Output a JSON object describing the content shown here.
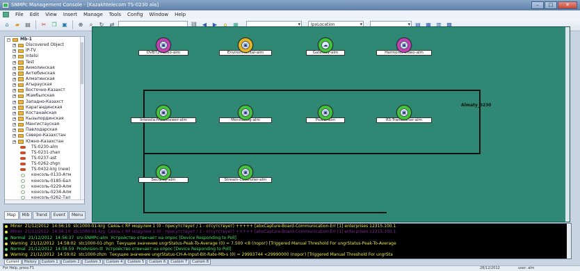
{
  "window": {
    "title": "SNMPc Management Console - [Kazakhtelecom TS-0230 ala]",
    "buttons": [
      "–",
      "□",
      "✕"
    ]
  },
  "menu": [
    "File",
    "Edit",
    "View",
    "Insert",
    "Manage",
    "Tools",
    "Config",
    "Window",
    "Help"
  ],
  "toolbar": {
    "icons": [
      "app-icon",
      "folder-icon",
      "print-icon",
      "cut-icon",
      "copy-icon",
      "paste-icon",
      "zoom-icon",
      "search-icon",
      "refresh-icon",
      "route-icon",
      "link-icon",
      "back-icon",
      "forward-icon",
      "home-icon",
      "map-icon"
    ],
    "zoom_value": "",
    "location_combo": "IpxLocation",
    "field_combo": "",
    "right_icons": [
      "table-icon",
      "grid-icon",
      "chart-icon",
      "bars-icon"
    ]
  },
  "tree": {
    "items": [
      {
        "label": "Mb-1",
        "kind": "root",
        "indent": 0
      },
      {
        "label": "Discovered Object",
        "kind": "folder",
        "indent": 1
      },
      {
        "label": "IP-TV",
        "kind": "folder",
        "indent": 1
      },
      {
        "label": "Intelsi",
        "kind": "folder",
        "indent": 1
      },
      {
        "label": "Test",
        "kind": "folder",
        "indent": 1
      },
      {
        "label": "Акмолинская",
        "kind": "folder",
        "indent": 1
      },
      {
        "label": "Актюбинская",
        "kind": "folder",
        "indent": 1
      },
      {
        "label": "Алматинская",
        "kind": "folder",
        "indent": 1
      },
      {
        "label": "Атырауская",
        "kind": "folder",
        "indent": 1
      },
      {
        "label": "Восточно-Казахст",
        "kind": "folder",
        "indent": 1
      },
      {
        "label": "Жамбылская",
        "kind": "folder",
        "indent": 1
      },
      {
        "label": "Западно-Казахст",
        "kind": "folder",
        "indent": 1
      },
      {
        "label": "Карагандинская",
        "kind": "folder",
        "indent": 1
      },
      {
        "label": "Костанайская",
        "kind": "folder",
        "indent": 1
      },
      {
        "label": "Кызылординская",
        "kind": "folder",
        "indent": 1
      },
      {
        "label": "Мангистауская",
        "kind": "folder",
        "indent": 1
      },
      {
        "label": "Павлодарская",
        "kind": "folder",
        "indent": 1
      },
      {
        "label": "Северо-Казахстан",
        "kind": "folder",
        "indent": 1
      },
      {
        "label": "Южно-Казахстан",
        "kind": "folder",
        "indent": 1
      },
      {
        "label": "TS-0230-alm",
        "kind": "device",
        "indent": 2
      },
      {
        "label": "TS-0231-zhan",
        "kind": "device",
        "indent": 2
      },
      {
        "label": "TS-0237-ast",
        "kind": "device",
        "indent": 2
      },
      {
        "label": "TS-0262-zhgn",
        "kind": "device",
        "indent": 2
      },
      {
        "label": "TS-0432-krg (new)",
        "kind": "device",
        "indent": 2
      },
      {
        "label": "консоль-0133-Атм",
        "kind": "sub",
        "indent": 2
      },
      {
        "label": "консоль-0185-Бал",
        "kind": "sub",
        "indent": 2
      },
      {
        "label": "консоль-0229-Алм",
        "kind": "sub",
        "indent": 2
      },
      {
        "label": "консоль-0234-Алм",
        "kind": "sub",
        "indent": 2
      },
      {
        "label": "консоль-0262-Тал",
        "kind": "sub",
        "indent": 2
      }
    ]
  },
  "left_tabs": [
    "Map",
    "Mib",
    "Trend",
    "Event",
    "Menu"
  ],
  "map": {
    "name": "Almaty_0230",
    "nodes": [
      {
        "label": "DVBT2-Audio-alm",
        "color": "#c23fb6",
        "kind": "dev",
        "col": 0,
        "row": 0
      },
      {
        "label": "Environmental-alm",
        "color": "#e6b321",
        "kind": "dev",
        "col": 1,
        "row": 0
      },
      {
        "label": "Gateway-alm",
        "color": "#42c43a",
        "kind": "cloud",
        "col": 2,
        "row": 0
      },
      {
        "label": "Harmonic-Video-alm",
        "color": "#c23fb6",
        "kind": "dev",
        "col": 3,
        "row": 0
      },
      {
        "label": "Inteosla-Multiviewer-alm",
        "color": "#42c43a",
        "kind": "dev",
        "col": 0,
        "row": 1
      },
      {
        "label": "Monitoring-alm",
        "color": "#42c43a",
        "kind": "dev",
        "col": 1,
        "row": 1
      },
      {
        "label": "Power-alm",
        "color": "#42c43a",
        "kind": "dev",
        "col": 2,
        "row": 1
      },
      {
        "label": "RS-Transmitter-alm",
        "color": "#42c43a",
        "kind": "dev",
        "col": 3,
        "row": 1
      },
      {
        "label": "Security-alm",
        "color": "#42c43a",
        "kind": "dev",
        "col": 0,
        "row": 2
      },
      {
        "label": "Stream-Controller-alm",
        "color": "#42c43a",
        "kind": "dev",
        "col": 1,
        "row": 2
      }
    ]
  },
  "alarms": [
    {
      "severity": "Minor",
      "date": "21/12/2012",
      "time": "14:56:10",
      "source": "stc1000-01-krg",
      "text": "Связь с RF модулем 1 (0 - присутствует / 1 - отсутствует) +++++ [abxCapture-Board-Communication-Err [1] enterprises 12315.100.1",
      "color": "#e8e84a",
      "dot": "#e8e84a"
    },
    {
      "severity": "Minor",
      "date": "21/12/2012",
      "time": "14:56:10",
      "source": "stc1000-01-krg",
      "text": "Связь с RF модулем 1 (0 - присутствует / 1 - отсутствует) +++++ [abxCapture-Board-Communication-Err [1] enterprises 12315.100.1",
      "color": "#7a2a96",
      "dot": "#e8e84a"
    },
    {
      "severity": "Normal",
      "date": "21/12/2012",
      "time": "14:56:37",
      "source": "srv-SNMPc-alm",
      "text": "Устройство отвечает на опрос   [Device Responding to Poll]",
      "color": "#49e26a",
      "dot": "#49e26a"
    },
    {
      "severity": "Warning",
      "date": "21/12/2012",
      "time": "14:58:02",
      "source": "stc1000-01-zhgn",
      "text": "Текущее значение ungrStatus-Peak-To-Average (0) = 7.500 <8 (порог) [Triggered Manual Threshold For ungrStatus-Peak-To-Average",
      "color": "#e8e84a",
      "dot": "#e8e84a"
    },
    {
      "severity": "Normal",
      "date": "21/12/2012",
      "time": "14:58:59",
      "source": "Prodvision-tt",
      "text": "Устройство отвечает на опрос   [Device Responding to Poll]",
      "color": "#49e26a",
      "dot": "#49e26a"
    },
    {
      "severity": "Warning",
      "date": "21/12/2012",
      "time": "14:59:02",
      "source": "stc1000-zhzn",
      "text": "Текущее значение ungrStatus-CH-A-Input-Bit-Rate-Mb-s (0) = 29993744 <29990000 (порог) [Triggered Manual Threshold For ungrSta",
      "color": "#e8e84a",
      "dot": "#e8e84a"
    }
  ],
  "bottom_tabs": [
    "Current",
    "History",
    "Custom 1",
    "Custom 2",
    "Custom 3",
    "Custom 4",
    "Custom 5",
    "Custom 6",
    "Custom 7",
    "Custom 8"
  ],
  "statusbar": {
    "left": "For Help, press F1",
    "middle": "28/12/2012",
    "right": "user: alm"
  }
}
